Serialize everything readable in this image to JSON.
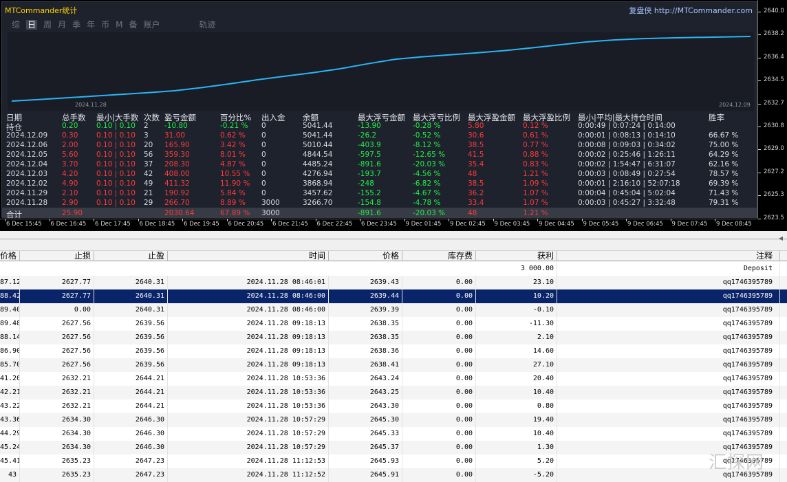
{
  "panel": {
    "title": "MTCommander统计",
    "link": "复盘侠 http://MTCommander.com",
    "tabs": [
      "综",
      "日",
      "周",
      "月",
      "季",
      "年",
      "币",
      "M",
      "备",
      "账户",
      "轨迹"
    ],
    "active_tab": "日",
    "mini_start": "2024.11.28",
    "mini_end": "2024.12.09",
    "mini_curve": [
      0,
      6,
      13,
      20,
      27,
      34,
      42,
      55,
      70,
      86,
      100,
      114,
      130,
      150,
      168,
      178,
      186,
      194,
      203,
      214,
      226,
      238,
      246,
      251,
      254,
      256,
      258,
      260
    ],
    "line_color": "#29b6f6",
    "stats_headers": [
      "日期",
      "总手数",
      "最小|大手数",
      "次数",
      "盈亏金额",
      "百分比%",
      "出入金",
      "余额",
      "最大浮亏金额",
      "最大浮亏比例",
      "最大浮盈金额",
      "最大浮盈比例",
      "最小|平均|最大持仓时间",
      "胜率"
    ],
    "stats_rows": [
      [
        "持仓",
        "0.20",
        "0.10 | 0.10",
        "2",
        "-10.80",
        "-0.21 %",
        "0",
        "5041.44",
        "-13.90",
        "-0.28 %",
        "5.80",
        "0.12 %",
        "0:00:49 | 0:07:24 | 0:14:00",
        ""
      ],
      [
        "2024.12.09",
        "0.30",
        "0.10 | 0.10",
        "3",
        "31.00",
        "0.62 %",
        "0",
        "5041.44",
        "-26.2",
        "-0.52 %",
        "30.6",
        "0.61 %",
        "0:00:01 | 0:08:13 | 0:14:10",
        "66.67 %"
      ],
      [
        "2024.12.06",
        "2.00",
        "0.10 | 0.10",
        "20",
        "165.90",
        "3.42 %",
        "0",
        "5010.44",
        "-403.9",
        "-8.12 %",
        "38.5",
        "0.77 %",
        "0:00:08 | 0:09:03 | 0:34:02",
        "75.00 %"
      ],
      [
        "2024.12.05",
        "5.60",
        "0.10 | 0.10",
        "56",
        "359.30",
        "8.01 %",
        "0",
        "4844.54",
        "-597.5",
        "-12.65 %",
        "41.5",
        "0.88 %",
        "0:00:02 | 0:25:46 | 1:26:11",
        "64.29 %"
      ],
      [
        "2024.12.04",
        "3.70",
        "0.10 | 0.10",
        "37",
        "208.30",
        "4.87 %",
        "0",
        "4485.24",
        "-891.6",
        "-20.03 %",
        "35.4",
        "0.83 %",
        "0:00:02 | 1:54:47 | 6:31:07",
        "62.16 %"
      ],
      [
        "2024.12.03",
        "4.20",
        "0.10 | 0.10",
        "42",
        "408.00",
        "10.55 %",
        "0",
        "4276.94",
        "-193.7",
        "-4.56 %",
        "48",
        "1.21 %",
        "0:00:03 | 0:08:49 | 0:27:54",
        "78.57 %"
      ],
      [
        "2024.12.02",
        "4.90",
        "0.10 | 0.10",
        "49",
        "411.32",
        "11.90 %",
        "0",
        "3868.94",
        "-248",
        "-6.82 %",
        "38.5",
        "1.09 %",
        "0:00:01 | 2:16:10 | 52:07:18",
        "69.39 %"
      ],
      [
        "2024.11.29",
        "2.10",
        "0.10 | 0.10",
        "21",
        "190.92",
        "5.84 %",
        "0",
        "3457.62",
        "-155.2",
        "-4.67 %",
        "36.2",
        "1.07 %",
        "0:00:04 | 0:45:04 | 5:02:04",
        "71.43 %"
      ],
      [
        "2024.11.28",
        "2.90",
        "0.10 | 0.10",
        "29",
        "266.70",
        "8.89 %",
        "3000",
        "3266.70",
        "-154.8",
        "-4.78 %",
        "33.4",
        "1.07 %",
        "0:00:03 | 0:45:27 | 3:32:48",
        "79.31 %"
      ],
      [
        "合计",
        "25.90",
        "",
        "",
        "2030.64",
        "67.89 %",
        "3000",
        "",
        "-891.6",
        "-20.03 %",
        "48",
        "1.21 %",
        "",
        ""
      ]
    ],
    "colors": {
      "green": "#22ee44",
      "red": "#ff3b3b",
      "white": "#d7dade"
    }
  },
  "price_scale": [
    "2640.0",
    "2638.2",
    "2636.4",
    "2634.5",
    "2632.7",
    "2630.8",
    "2629.0",
    "2627.2",
    "2625.3",
    "2623.5"
  ],
  "time_scale": [
    "6 Dec 15:45",
    "6 Dec 16:45",
    "6 Dec 17:45",
    "6 Dec 18:45",
    "6 Dec 19:45",
    "6 Dec 20:45",
    "6 Dec 21:45",
    "6 Dec 22:45",
    "6 Dec 23:45",
    "9 Dec 01:45",
    "9 Dec 02:45",
    "9 Dec 03:45",
    "9 Dec 04:45",
    "9 Dec 05:45",
    "9 Dec 06:45",
    "9 Dec 07:45",
    "9 Dec 08:45"
  ],
  "table": {
    "headers": [
      "价格",
      "止损",
      "止盈",
      "时间",
      "价格",
      "库存费",
      "获利",
      "注释"
    ],
    "deposit_row": {
      "profit": "3 000.00",
      "comment": "Deposit"
    },
    "rows": [
      [
        "87.12",
        "2627.77",
        "2640.31",
        "2024.11.28 08:46:01",
        "2639.43",
        "0.00",
        "23.10",
        "qq1746395789"
      ],
      [
        "88.42",
        "2627.77",
        "2640.31",
        "2024.11.28 08:46:00",
        "2639.44",
        "0.00",
        "10.20",
        "qq1746395789"
      ],
      [
        "89.40",
        "0.00",
        "2640.31",
        "2024.11.28 08:46:00",
        "2639.39",
        "0.00",
        "-0.10",
        "qq1746395789"
      ],
      [
        "89.48",
        "2627.56",
        "2639.56",
        "2024.11.28 09:18:13",
        "2638.35",
        "0.00",
        "-11.30",
        "qq1746395789"
      ],
      [
        "88.14",
        "2627.56",
        "2639.56",
        "2024.11.28 09:18:13",
        "2638.35",
        "0.00",
        "2.10",
        "qq1746395789"
      ],
      [
        "86.90",
        "2627.56",
        "2639.56",
        "2024.11.28 09:18:13",
        "2638.36",
        "0.00",
        "14.60",
        "qq1746395789"
      ],
      [
        "85.70",
        "2627.56",
        "2639.56",
        "2024.11.28 09:18:13",
        "2638.41",
        "0.00",
        "27.10",
        "qq1746395789"
      ],
      [
        "41.20",
        "2632.21",
        "2644.21",
        "2024.11.28 10:53:36",
        "2643.24",
        "0.00",
        "20.40",
        "qq1746395789"
      ],
      [
        "42.21",
        "2632.21",
        "2644.21",
        "2024.11.28 10:53:36",
        "2643.25",
        "0.00",
        "10.40",
        "qq1746395789"
      ],
      [
        "43.22",
        "2632.21",
        "2644.21",
        "2024.11.28 10:53:36",
        "2643.30",
        "0.00",
        "0.80",
        "qq1746395789"
      ],
      [
        "43.36",
        "2634.30",
        "2646.30",
        "2024.11.28 10:57:29",
        "2645.30",
        "0.00",
        "19.40",
        "qq1746395789"
      ],
      [
        "44.29",
        "2634.30",
        "2646.30",
        "2024.11.28 10:57:29",
        "2645.33",
        "0.00",
        "10.40",
        "qq1746395789"
      ],
      [
        "45.24",
        "2634.30",
        "2646.30",
        "2024.11.28 10:57:29",
        "2645.37",
        "0.00",
        "1.30",
        "qq1746395789"
      ],
      [
        "45.41",
        "2635.23",
        "2647.23",
        "2024.11.28 11:12:53",
        "2645.93",
        "0.00",
        "5.20",
        "qq1746395789"
      ],
      [
        "43",
        "2635.23",
        "2647.23",
        "2024.11.28 11:12:52",
        "2645.91",
        "0.00",
        "-5.20",
        "qq1746395789"
      ]
    ],
    "selected_row": 1
  },
  "watermark": "汇探网"
}
